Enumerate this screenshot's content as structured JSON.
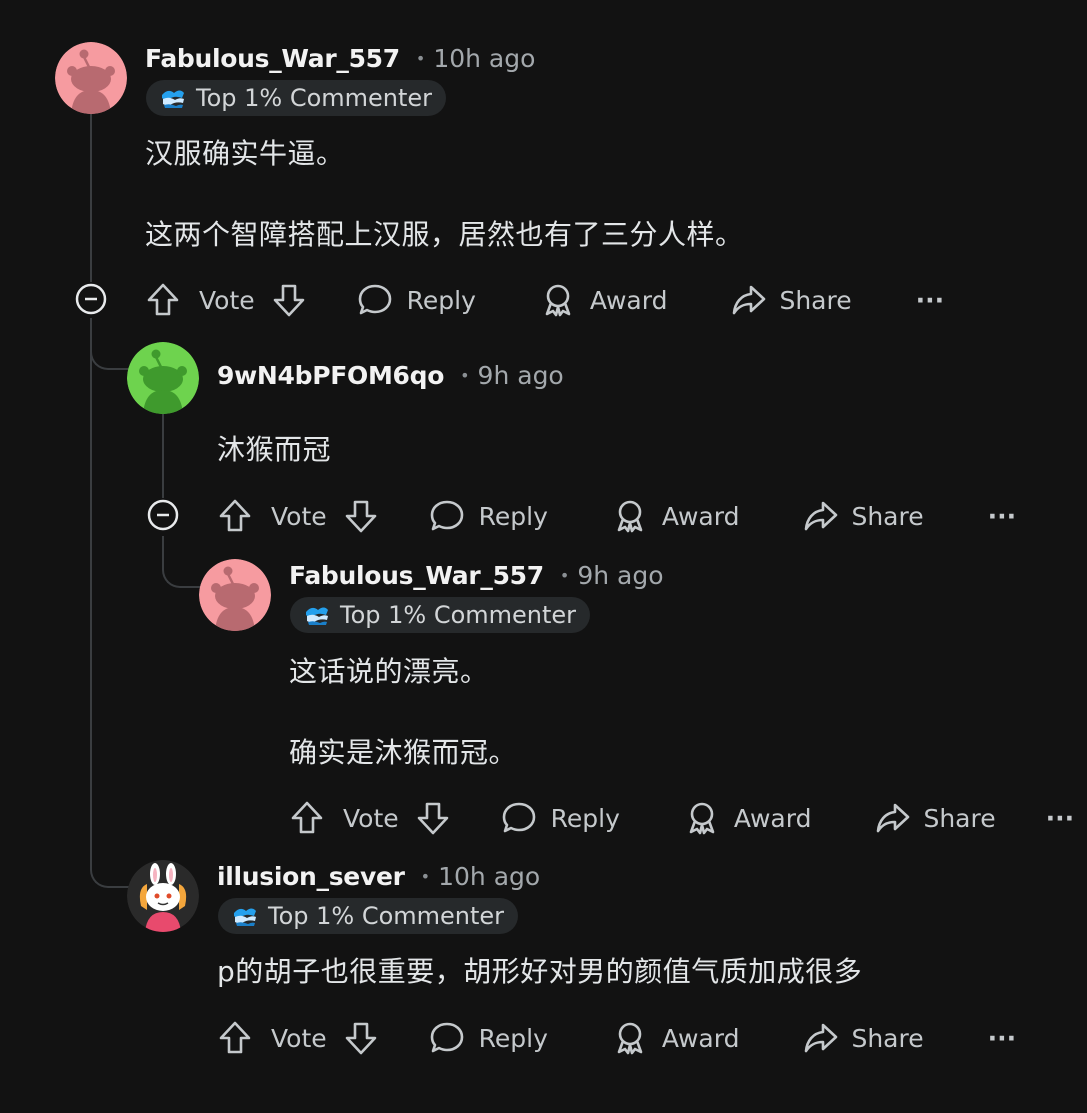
{
  "actions": {
    "vote": "Vote",
    "reply": "Reply",
    "award": "Award",
    "share": "Share",
    "more": "···"
  },
  "comments": [
    {
      "username": "Fabulous_War_557",
      "separator": "•",
      "time": "10h ago",
      "badge": "Top 1% Commenter",
      "avatar_color": "#f69ba0",
      "lines": [
        "汉服确实牛逼。",
        "这两个智障搭配上汉服，居然也有了三分人样。"
      ]
    },
    {
      "username": "9wN4bPFOM6qo",
      "separator": "•",
      "time": "9h ago",
      "avatar_color": "#6ed34e",
      "lines": [
        "沐猴而冠"
      ]
    },
    {
      "username": "Fabulous_War_557",
      "separator": "•",
      "time": "9h ago",
      "badge": "Top 1% Commenter",
      "avatar_color": "#f69ba0",
      "lines": [
        "这话说的漂亮。",
        "确实是沐猴而冠。"
      ]
    },
    {
      "username": "illusion_sever",
      "separator": "•",
      "time": "10h ago",
      "badge": "Top 1% Commenter",
      "avatar_color": "#2a2a2a",
      "lines": [
        "p的胡子也很重要，胡形好对男的颜值气质加成很多"
      ]
    }
  ],
  "colors": {
    "background": "#121212",
    "thread_line": "#3a3d40",
    "badge_bg": "#26292b"
  }
}
